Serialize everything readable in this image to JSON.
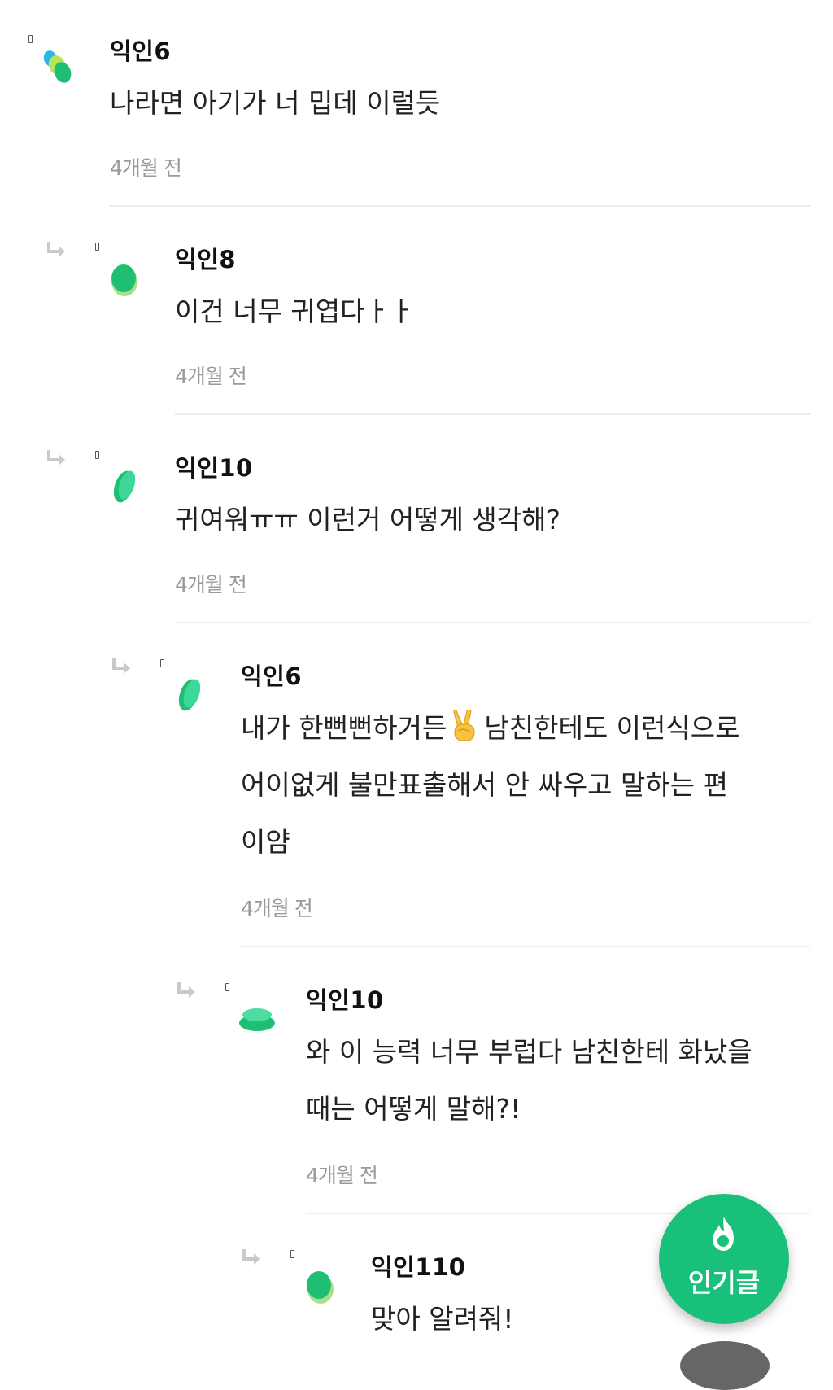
{
  "comments": [
    {
      "author": "익인6",
      "text_lines": [
        "나라면 아기가 너 밉데 이럴듯"
      ],
      "time": "4개월 전"
    },
    {
      "author": "익인8",
      "text_lines": [
        "이건 너무 귀엽다ㅏㅏ"
      ],
      "time": "4개월 전"
    },
    {
      "author": "익인10",
      "text_lines": [
        "귀여워ㅠㅠ 이런거 어떻게 생각해?"
      ],
      "time": "4개월 전"
    },
    {
      "author": "익인6",
      "text_before_emoji": "내가 한뻔뻔하거든",
      "text_after_emoji": "남친한테도 이런식으로",
      "text_lines": [
        "어이없게 불만표출해서 안 싸우고 말하는 편",
        "이얌"
      ],
      "time": "4개월 전"
    },
    {
      "author": "익인10",
      "text_lines": [
        "와 이 능력 너무 부럽다 남친한테 화났을",
        "때는 어떻게 말해?!"
      ],
      "time": "4개월 전"
    },
    {
      "author": "익인110",
      "text_lines": [
        "맞아 알려줘!"
      ]
    }
  ],
  "fab": {
    "label": "인기글",
    "icon": "fire-icon",
    "color": "#19c07a"
  },
  "colors": {
    "accent_green": "#1fc47a",
    "divider": "#ececec",
    "time_gray": "#9a9a9a"
  }
}
